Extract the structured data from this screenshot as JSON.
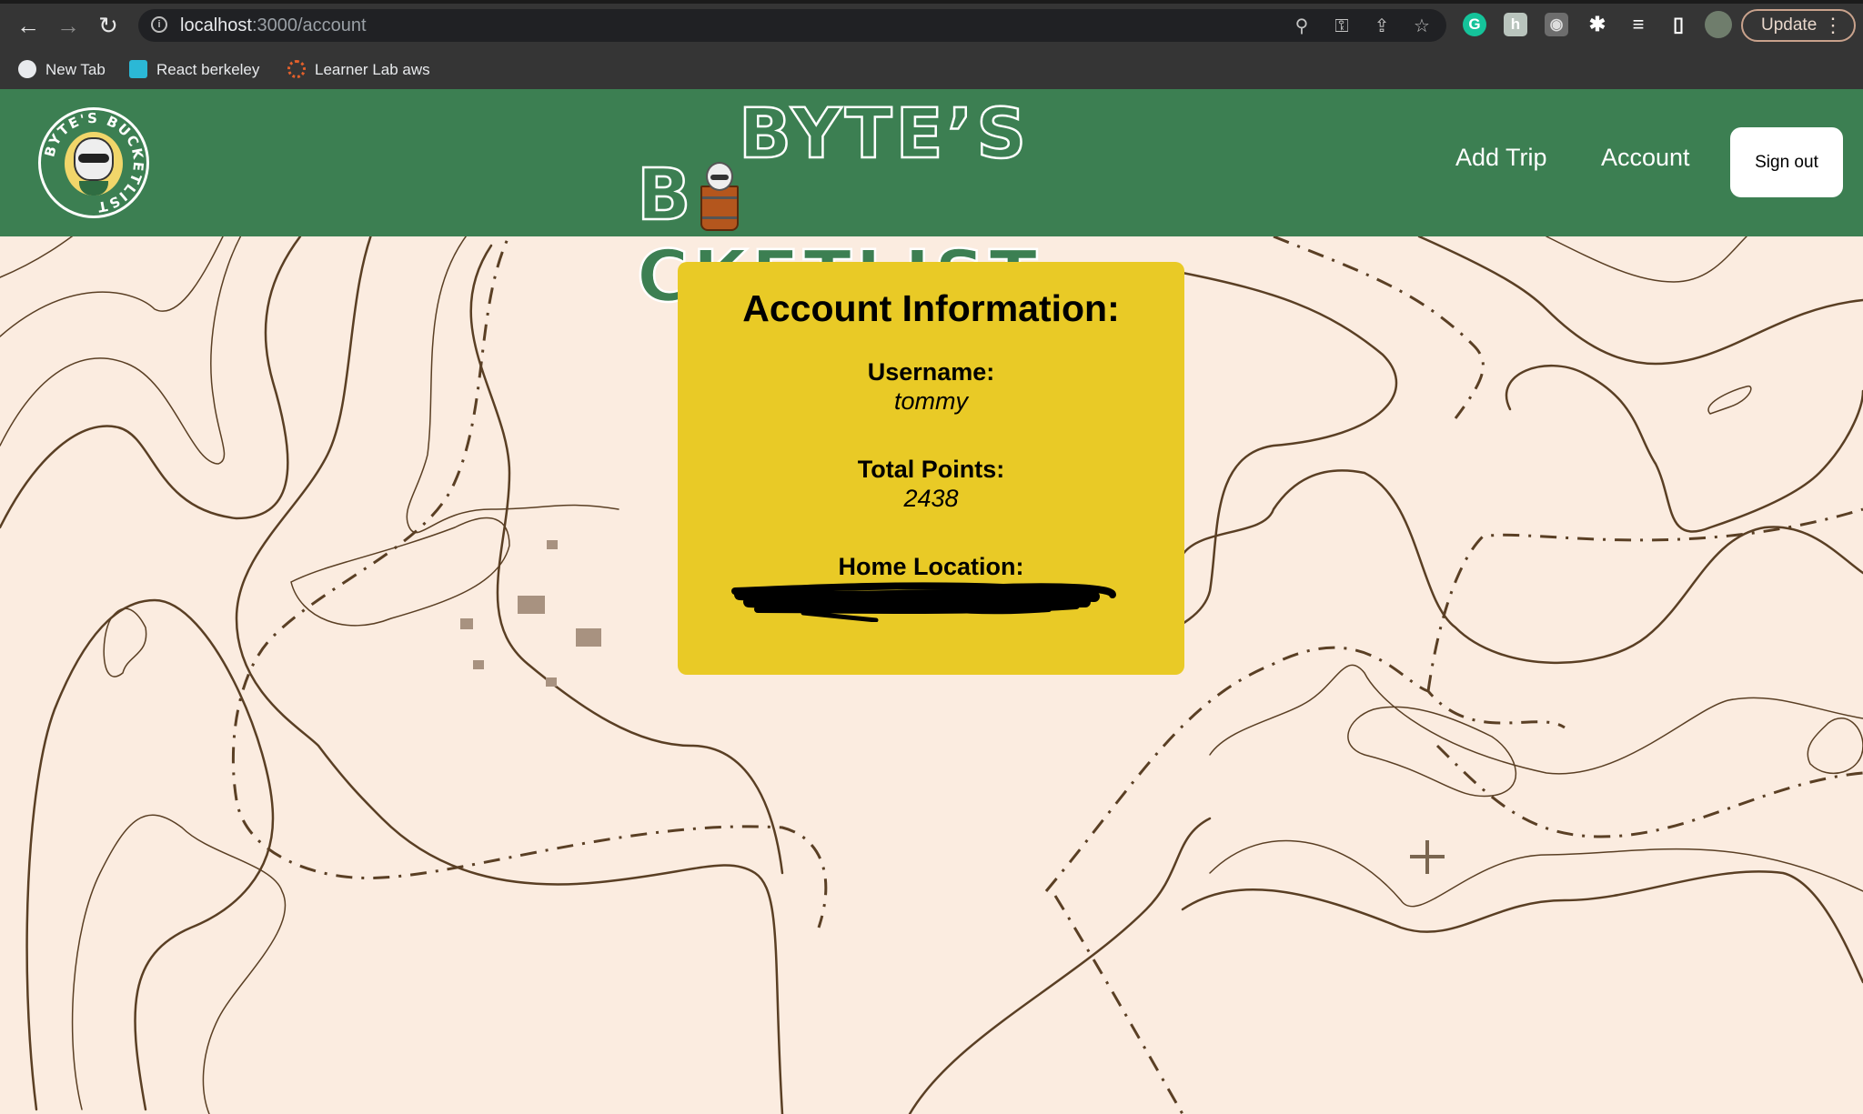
{
  "browser": {
    "url_host": "localhost",
    "url_path": ":3000/account",
    "nav": {
      "back_icon": "arrow-left-icon",
      "forward_icon": "arrow-right-icon",
      "reload_icon": "reload-icon"
    },
    "omnibox_icons": [
      "location-pin-icon",
      "key-icon",
      "share-icon",
      "star-icon"
    ],
    "extensions": [
      {
        "name": "grammarly-icon",
        "glyph": "G",
        "color": "#15c39a"
      },
      {
        "name": "h-extension-icon",
        "glyph": "h",
        "color": "#b9c4bd"
      },
      {
        "name": "camera-icon",
        "glyph": "◉",
        "color": "#8a8a8a"
      },
      {
        "name": "puzzle-icon",
        "glyph": "✱",
        "color": "#ffffff"
      },
      {
        "name": "media-list-icon",
        "glyph": "≡",
        "color": "#ffffff"
      },
      {
        "name": "sidebar-icon",
        "glyph": "▯",
        "color": "#ffffff"
      }
    ],
    "update_label": "Update",
    "bookmarks": [
      {
        "label": "New Tab",
        "icon": "globe-icon",
        "color": "#e8eaed"
      },
      {
        "label": "React berkeley",
        "icon": "monitor-icon",
        "color": "#2bb8d6"
      },
      {
        "label": "Learner Lab aws",
        "icon": "canvas-icon",
        "color": "#e3602b"
      }
    ]
  },
  "header": {
    "title_line1": "BYTE’S",
    "title_line2_pre": "B",
    "title_line2_post": "CKETLIST",
    "logo_text": "BYTE'S BUCKETLIST",
    "nav": [
      {
        "label": "Add Trip"
      },
      {
        "label": "Account"
      }
    ],
    "signout_label": "Sign out",
    "brand_color": "#3c7f52"
  },
  "account": {
    "heading": "Account Information:",
    "fields": [
      {
        "label": "Username:",
        "value": "tommy"
      },
      {
        "label": "Total Points:",
        "value": "2438"
      },
      {
        "label": "Home Location:",
        "value": "[redacted]"
      }
    ],
    "card_color": "#e9ca26"
  }
}
